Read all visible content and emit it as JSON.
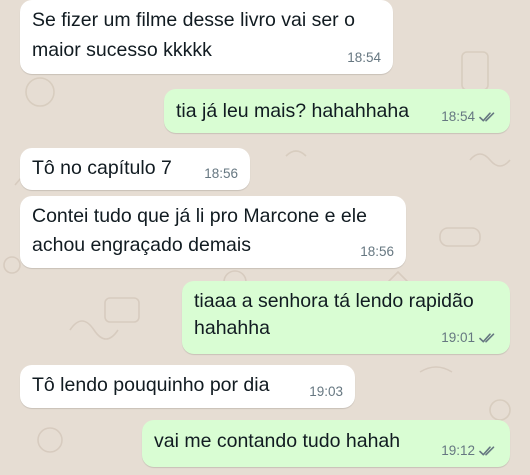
{
  "chat": {
    "messages": [
      {
        "direction": "incoming",
        "lines": [
          "Se fizer um filme desse livro vai ser o",
          "maior sucesso kkkkk"
        ],
        "time": "18:54"
      },
      {
        "direction": "outgoing",
        "lines": [
          "tia já leu mais? hahahhaha"
        ],
        "time": "18:54",
        "status": "read"
      },
      {
        "direction": "incoming",
        "lines": [
          "Tô no capítulo 7"
        ],
        "time": "18:56"
      },
      {
        "direction": "incoming",
        "lines": [
          "Contei tudo que já li pro Marcone e ele",
          "achou engraçado demais"
        ],
        "time": "18:56"
      },
      {
        "direction": "outgoing",
        "lines": [
          "tiaaa a senhora tá lendo rapidão",
          "hahahha"
        ],
        "time": "19:01",
        "status": "read"
      },
      {
        "direction": "incoming",
        "lines": [
          "Tô lendo pouquinho por dia"
        ],
        "time": "19:03"
      },
      {
        "direction": "outgoing",
        "lines": [
          "vai me contando tudo hahah"
        ],
        "time": "19:12",
        "status": "read"
      }
    ]
  },
  "colors": {
    "wallpaper": "#e6ddd3",
    "incoming_bubble": "#ffffff",
    "outgoing_bubble": "#d9fdd3",
    "message_text": "#111b21",
    "timestamp": "#667781",
    "read_ticks": "#667781"
  },
  "icons": {
    "read_receipt": "double-check-icon"
  }
}
